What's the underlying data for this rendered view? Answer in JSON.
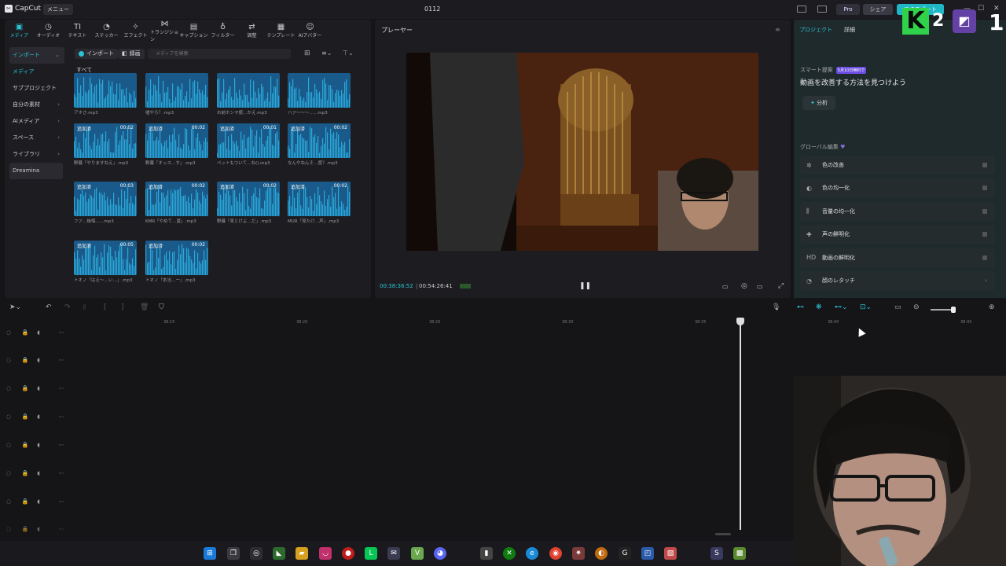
{
  "titlebar": {
    "app": "CapCut",
    "menu": "メニュー",
    "title": "0112",
    "pro": "Pro",
    "share": "シェア",
    "export": "エクスポート"
  },
  "toolbar": [
    {
      "label": "メディア",
      "icon": "▣",
      "active": true
    },
    {
      "label": "オーディオ",
      "icon": "◷"
    },
    {
      "label": "テキスト",
      "icon": "TI"
    },
    {
      "label": "ステッカー",
      "icon": "◔"
    },
    {
      "label": "エフェクト",
      "icon": "✧"
    },
    {
      "label": "トランジション",
      "icon": "⋈"
    },
    {
      "label": "キャプション",
      "icon": "▤"
    },
    {
      "label": "フィルター",
      "icon": "♁"
    },
    {
      "label": "調整",
      "icon": "⇄"
    },
    {
      "label": "テンプレート",
      "icon": "▦"
    },
    {
      "label": "AIアバター",
      "icon": "☺"
    }
  ],
  "sidebar": [
    {
      "label": "インポート",
      "active": true,
      "arrow": "⌄"
    },
    {
      "label": "メディア",
      "sub": true
    },
    {
      "label": "サブプロジェクト"
    },
    {
      "label": "自分の素材",
      "arrow": "›"
    },
    {
      "label": "AIメディア",
      "arrow": "›"
    },
    {
      "label": "スペース",
      "arrow": "›"
    },
    {
      "label": "ライブラリ",
      "arrow": "›"
    },
    {
      "label": "Dreamina",
      "dream": true
    }
  ],
  "media_tabs": {
    "import": "インポート",
    "record": "録画",
    "search_placeholder": "メディアを検索"
  },
  "media_section": "すべて",
  "media": [
    {
      "label": "アホさ.mp3",
      "badge": "",
      "duration": ""
    },
    {
      "label": "嘘やろ？.mp3",
      "badge": "",
      "duration": ""
    },
    {
      "label": "お前ホンマ使…かえ.mp3",
      "badge": "",
      "duration": ""
    },
    {
      "label": "ハァ〜〜〜…‥.mp3",
      "badge": "",
      "duration": ""
    },
    {
      "label": "野暮「やりますねえ」.mp3",
      "badge": "追加済",
      "duration": "00:02"
    },
    {
      "label": "野暮「オッス…す」.mp3",
      "badge": "追加済",
      "duration": "00:02"
    },
    {
      "label": "ペットもついて…ね().mp3",
      "badge": "追加済",
      "duration": "00:01"
    },
    {
      "label": "なんやねんそ…度？.mp3",
      "badge": "追加済",
      "duration": "00:02"
    },
    {
      "label": "ファ…後悔…‥.mp3",
      "badge": "追加済",
      "duration": "00:03"
    },
    {
      "label": "KMR「やめて…夏」.mp3",
      "badge": "追加済",
      "duration": "00:02"
    },
    {
      "label": "野暮「見とけよ…だ」.mp3",
      "badge": "追加済",
      "duration": "00:02"
    },
    {
      "label": "MUR「見たけ…声」.mp3",
      "badge": "追加済",
      "duration": "00:02"
    },
    {
      "label": "トオノ「はえ〜…い…」.mp3",
      "badge": "追加済",
      "duration": "00:05"
    },
    {
      "label": "トオノ「本当…ー」.mp3",
      "badge": "追加済",
      "duration": "00:02"
    }
  ],
  "player": {
    "title": "プレーヤー",
    "current": "00:38:36:52",
    "total": "00:54:26:41"
  },
  "right": {
    "tabs": [
      "プロジェクト",
      "詳細"
    ],
    "smart_label": "スマート提案",
    "smart_badge": "5月10日無料で",
    "smart_title": "動画を改善する方法を見つけよう",
    "analyze": "分析",
    "global_label": "グローバル編集",
    "items": [
      {
        "icon": "✲",
        "label": "色の改善"
      },
      {
        "icon": "◐",
        "label": "色の均一化"
      },
      {
        "icon": "⫼",
        "label": "音量の均一化"
      },
      {
        "icon": "✚",
        "label": "声の鮮明化"
      },
      {
        "icon": "HD",
        "label": "動画の鮮明化"
      },
      {
        "icon": "◔",
        "label": "顔のレタッチ"
      }
    ]
  },
  "ruler": [
    "38:15",
    "38:20",
    "38:25",
    "38:30",
    "38:35",
    "38:40",
    "38:45"
  ],
  "overlay": {
    "k": "K",
    "two": "2",
    "one": "1"
  }
}
